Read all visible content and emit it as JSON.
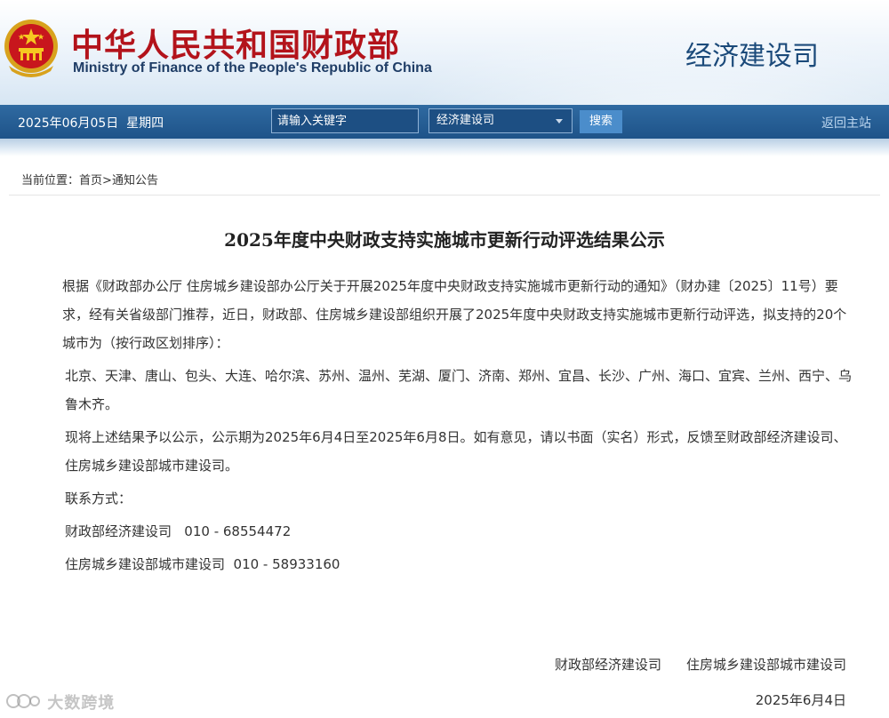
{
  "header": {
    "site_name_cn": "中华人民共和国财政部",
    "site_name_en": "Ministry of Finance of the People's Republic of China",
    "department": "经济建设司",
    "colors": {
      "brand_red": "#b3131b",
      "nav_blue": "#1e5389",
      "text_blue": "#1f3d66"
    },
    "emblem_icon": "national-emblem-icon"
  },
  "navbar": {
    "date": "2025年06月05日",
    "weekday": "星期四",
    "search_placeholder": "请输入关键字",
    "scope_selected": "经济建设司",
    "search_button": "搜索",
    "home_link": "返回主站"
  },
  "breadcrumb": {
    "prefix": "当前位置：",
    "home": "首页",
    "separator": ">",
    "current": "通知公告"
  },
  "article": {
    "title": "2025年度中央财政支持实施城市更新行动评选结果公示",
    "paragraphs": [
      "根据《财政部办公厅 住房城乡建设部办公厅关于开展2025年度中央财政支持实施城市更新行动的通知》（财办建〔2025〕11号）要求，经有关省级部门推荐，近日，财政部、住房城乡建设部组织开展了2025年度中央财政支持实施城市更新行动评选，拟支持的20个城市为（按行政区划排序）：",
      "北京、天津、唐山、包头、大连、哈尔滨、苏州、温州、芜湖、厦门、济南、郑州、宜昌、长沙、广州、海口、宜宾、兰州、西宁、乌鲁木齐。",
      "现将上述结果予以公示，公示期为2025年6月4日至2025年6月8日。如有意见，请以书面（实名）形式，反馈至财政部经济建设司、住房城乡建设部城市建设司。"
    ],
    "contact_heading": "联系方式：",
    "contacts": [
      "财政部经济建设司   010 - 68554472",
      "住房城乡建设部城市建设司  010 - 58933160"
    ],
    "signatures": [
      "财政部经济建设司",
      "住房城乡建设部城市建设司"
    ],
    "date": "2025年6月4日"
  },
  "watermark": {
    "text": "大数跨境",
    "icon": "watermark-logo-icon"
  }
}
